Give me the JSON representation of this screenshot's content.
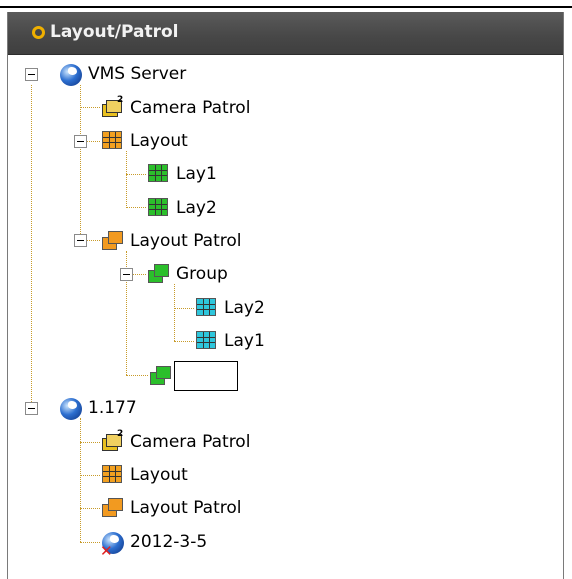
{
  "panel": {
    "title": "Layout/Patrol"
  },
  "tree": {
    "vms_server": {
      "label": "VMS Server",
      "camera_patrol": "Camera Patrol",
      "layout": {
        "label": "Layout",
        "children": [
          "Lay1",
          "Lay2"
        ]
      },
      "layout_patrol": {
        "label": "Layout Patrol",
        "group": {
          "label": "Group",
          "children": [
            "Lay2",
            "Lay1"
          ]
        },
        "new_item_value": ""
      }
    },
    "server_177": {
      "label": "1.177",
      "camera_patrol": "Camera Patrol",
      "layout": "Layout",
      "layout_patrol": "Layout Patrol",
      "offline_device": "2012-3-5"
    }
  },
  "icons": {
    "server": "globe-icon",
    "camera_patrol": "camera-patrol-icon",
    "layout": "layout-grid-icon",
    "layout_patrol": "layout-patrol-icon",
    "offline": "offline-globe-icon"
  },
  "colors": {
    "header_bg": "#474747",
    "header_text": "#f2f2f2",
    "accent": "#f0b000",
    "tree_line": "#c89b2a"
  }
}
